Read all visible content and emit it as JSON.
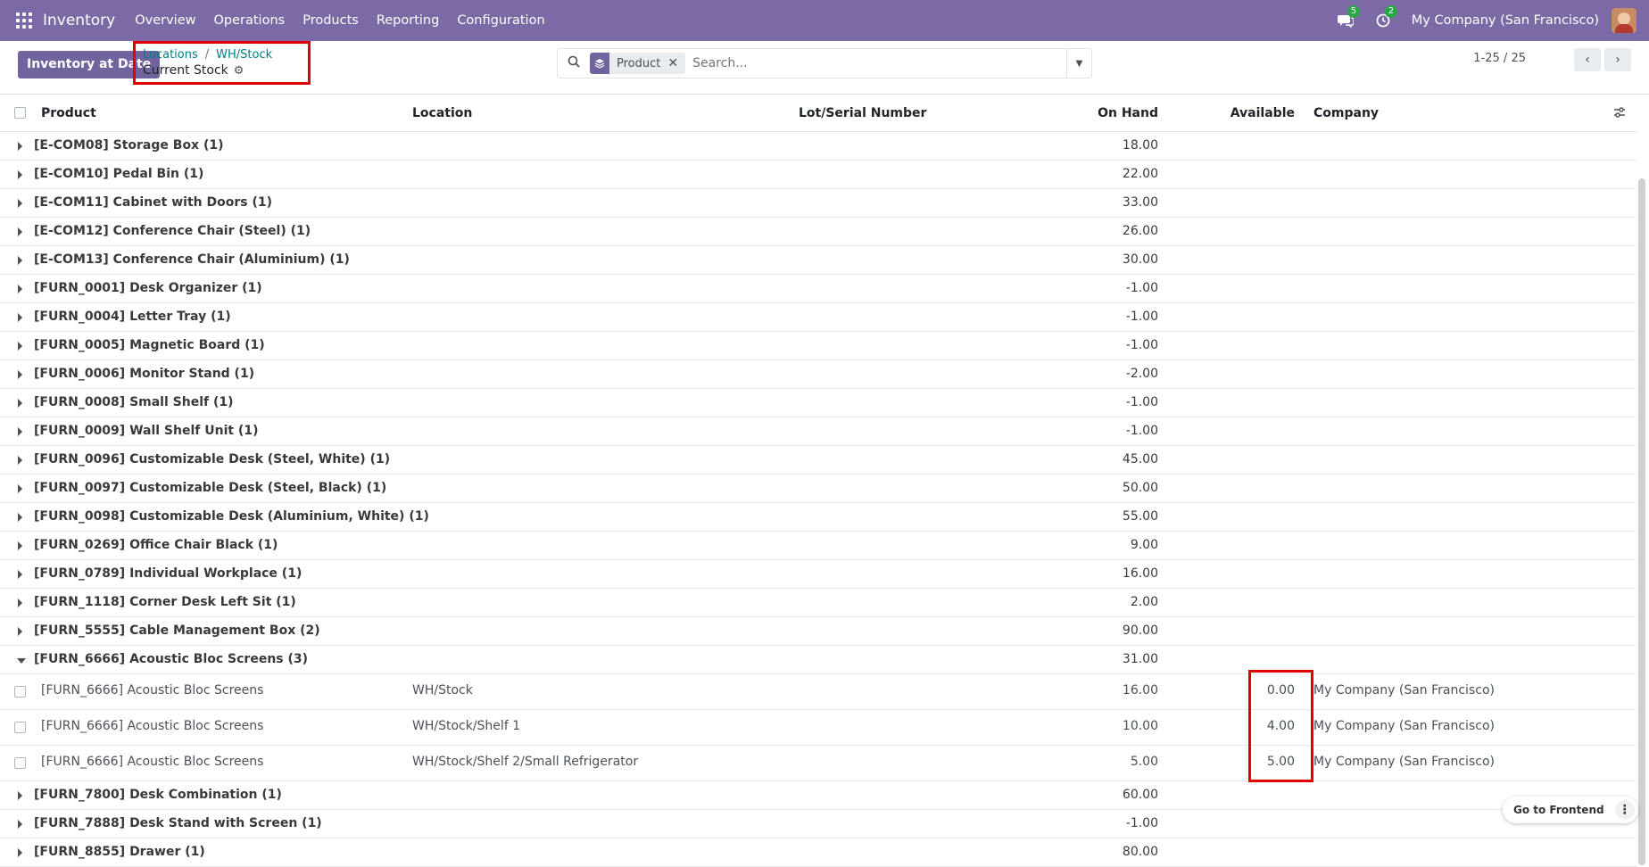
{
  "navbar": {
    "brand": "Inventory",
    "menu": [
      "Overview",
      "Operations",
      "Products",
      "Reporting",
      "Configuration"
    ],
    "chat_count": "5",
    "activity_count": "2",
    "company": "My Company (San Francisco)"
  },
  "control": {
    "primary_button": "Inventory at Date",
    "breadcrumb": [
      "Locations",
      "WH/Stock"
    ],
    "current": "Current Stock",
    "search": {
      "facet": "Product",
      "placeholder": "Search..."
    },
    "pager": "1-25 / 25"
  },
  "table": {
    "headers": {
      "product": "Product",
      "location": "Location",
      "lot": "Lot/Serial Number",
      "on_hand": "On Hand",
      "available": "Available",
      "company": "Company"
    },
    "groups_before": [
      {
        "label": "[E-COM08] Storage Box (1)",
        "qty": "18.00"
      },
      {
        "label": "[E-COM10] Pedal Bin (1)",
        "qty": "22.00"
      },
      {
        "label": "[E-COM11] Cabinet with Doors (1)",
        "qty": "33.00"
      },
      {
        "label": "[E-COM12] Conference Chair (Steel) (1)",
        "qty": "26.00"
      },
      {
        "label": "[E-COM13] Conference Chair (Aluminium) (1)",
        "qty": "30.00"
      },
      {
        "label": "[FURN_0001] Desk Organizer (1)",
        "qty": "-1.00"
      },
      {
        "label": "[FURN_0004] Letter Tray (1)",
        "qty": "-1.00"
      },
      {
        "label": "[FURN_0005] Magnetic Board (1)",
        "qty": "-1.00"
      },
      {
        "label": "[FURN_0006] Monitor Stand (1)",
        "qty": "-2.00"
      },
      {
        "label": "[FURN_0008] Small Shelf (1)",
        "qty": "-1.00"
      },
      {
        "label": "[FURN_0009] Wall Shelf Unit (1)",
        "qty": "-1.00"
      },
      {
        "label": "[FURN_0096] Customizable Desk (Steel, White) (1)",
        "qty": "45.00"
      },
      {
        "label": "[FURN_0097] Customizable Desk (Steel, Black) (1)",
        "qty": "50.00"
      },
      {
        "label": "[FURN_0098] Customizable Desk (Aluminium, White) (1)",
        "qty": "55.00"
      },
      {
        "label": "[FURN_0269] Office Chair Black (1)",
        "qty": "9.00"
      },
      {
        "label": "[FURN_0789] Individual Workplace (1)",
        "qty": "16.00"
      },
      {
        "label": "[FURN_1118] Corner Desk Left Sit (1)",
        "qty": "2.00"
      },
      {
        "label": "[FURN_5555] Cable Management Box (2)",
        "qty": "90.00"
      }
    ],
    "expanded_group": {
      "label": "[FURN_6666] Acoustic Bloc Screens (3)",
      "qty": "31.00"
    },
    "expanded_rows": [
      {
        "product": "[FURN_6666] Acoustic Bloc Screens",
        "location": "WH/Stock",
        "on_hand": "16.00",
        "available": "0.00",
        "company": "My Company (San Francisco)"
      },
      {
        "product": "[FURN_6666] Acoustic Bloc Screens",
        "location": "WH/Stock/Shelf 1",
        "on_hand": "10.00",
        "available": "4.00",
        "company": "My Company (San Francisco)"
      },
      {
        "product": "[FURN_6666] Acoustic Bloc Screens",
        "location": "WH/Stock/Shelf 2/Small Refrigerator",
        "on_hand": "5.00",
        "available": "5.00",
        "company": "My Company (San Francisco)"
      }
    ],
    "groups_after": [
      {
        "label": "[FURN_7800] Desk Combination (1)",
        "qty": "60.00"
      },
      {
        "label": "[FURN_7888] Desk Stand with Screen (1)",
        "qty": "-1.00"
      },
      {
        "label": "[FURN_8855] Drawer (1)",
        "qty": "80.00"
      }
    ]
  },
  "floating": {
    "go_frontend": "Go to Frontend"
  }
}
